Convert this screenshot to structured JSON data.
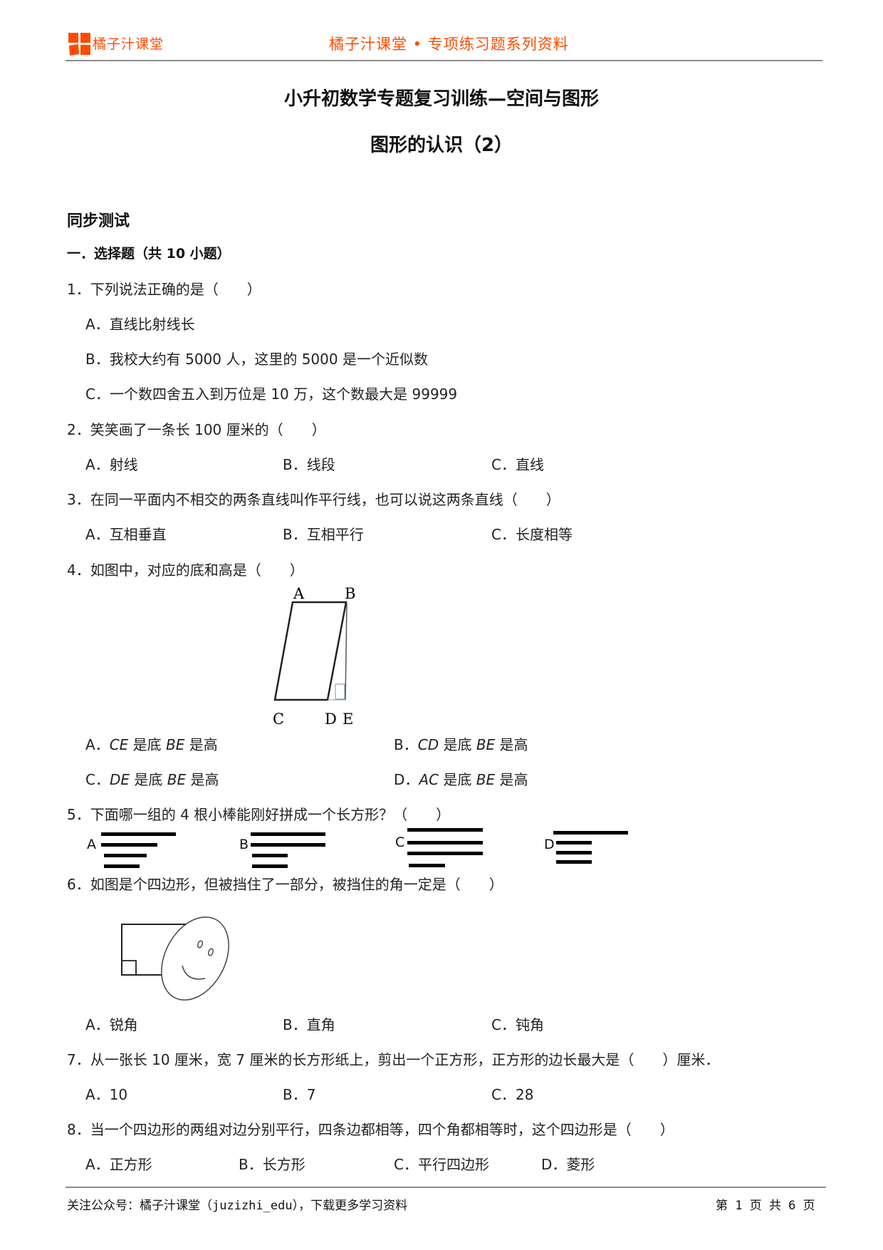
{
  "header": {
    "logo_text": "橘子汁课堂",
    "right_text": "橘子汁课堂 • 专项练习题系列资料",
    "accent_color": "#ff4a00"
  },
  "document": {
    "title": "小升初数学专题复习训练—空间与图形",
    "subtitle": "图形的认识（2）",
    "section": "同步测试",
    "part_heading": "一．选择题（共 10 小题）"
  },
  "questions": [
    {
      "number": "1．",
      "text": "下列说法正确的是（　　）",
      "options": [
        {
          "label": "A．",
          "text": "直线比射线长"
        },
        {
          "label": "B．",
          "text": "我校大约有 5000 人，这里的 5000 是一个近似数"
        },
        {
          "label": "C．",
          "text": "一个数四舍五入到万位是 10 万，这个数最大是 99999"
        }
      ]
    },
    {
      "number": "2．",
      "text": "笑笑画了一条长 100 厘米的（　　）",
      "options": [
        {
          "label": "A．",
          "text": "射线"
        },
        {
          "label": "B．",
          "text": "线段"
        },
        {
          "label": "C．",
          "text": "直线"
        }
      ]
    },
    {
      "number": "3．",
      "text": "在同一平面内不相交的两条直线叫作平行线，也可以说这两条直线（　　）",
      "options": [
        {
          "label": "A．",
          "text": "互相垂直"
        },
        {
          "label": "B．",
          "text": "互相平行"
        },
        {
          "label": "C．",
          "text": "长度相等"
        }
      ]
    },
    {
      "number": "4．",
      "text": "如图中，对应的底和高是（　　）",
      "figure": {
        "labels": [
          "A",
          "B",
          "C",
          "D",
          "E"
        ]
      },
      "options": [
        {
          "label": "A．",
          "seg1": "CE",
          "mid": " 是底 ",
          "seg2": "BE",
          "end": " 是高"
        },
        {
          "label": "B．",
          "seg1": "CD",
          "mid": " 是底 ",
          "seg2": "BE",
          "end": " 是高"
        },
        {
          "label": "C．",
          "seg1": "DE",
          "mid": " 是底 ",
          "seg2": "BE",
          "end": " 是高"
        },
        {
          "label": "D．",
          "seg1": "AC",
          "mid": " 是底 ",
          "seg2": "BE",
          "end": " 是高"
        }
      ]
    },
    {
      "number": "5．",
      "text": "下面哪一组的 4 根小棒能刚好拼成一个长方形？（　　）",
      "stick_groups": [
        {
          "label": "A",
          "relative_lengths": [
            1.0,
            0.75,
            0.57,
            0.48
          ]
        },
        {
          "label": "B",
          "relative_lengths": [
            1.0,
            1.0,
            0.48,
            0.48
          ]
        },
        {
          "label": "C",
          "relative_lengths": [
            1.0,
            1.0,
            1.0,
            0.48
          ]
        },
        {
          "label": "D",
          "relative_lengths": [
            1.0,
            0.48,
            0.48,
            0.48
          ]
        }
      ]
    },
    {
      "number": "6．",
      "text": "如图是个四边形，但被挡住了一部分，被挡住的角一定是（　　）",
      "options": [
        {
          "label": "A．",
          "text": "锐角"
        },
        {
          "label": "B．",
          "text": "直角"
        },
        {
          "label": "C．",
          "text": "钝角"
        }
      ]
    },
    {
      "number": "7．",
      "text": "从一张长 10 厘米，宽 7 厘米的长方形纸上，剪出一个正方形，正方形的边长最大是（　　）厘米．",
      "options": [
        {
          "label": "A．",
          "text": "10"
        },
        {
          "label": "B．",
          "text": "7"
        },
        {
          "label": "C．",
          "text": "28"
        }
      ]
    },
    {
      "number": "8．",
      "text": "当一个四边形的两组对边分别平行，四条边都相等，四个角都相等时，这个四边形是（　　）",
      "options": [
        {
          "label": "A．",
          "text": "正方形"
        },
        {
          "label": "B．",
          "text": "长方形"
        },
        {
          "label": "C．",
          "text": "平行四边形"
        },
        {
          "label": "D．",
          "text": "菱形"
        }
      ]
    }
  ],
  "footer": {
    "left_text": "关注公众号：橘子汁课堂（juzizhi_edu），下载更多学习资料",
    "page_indicator": "第 1 页 共 6 页"
  }
}
